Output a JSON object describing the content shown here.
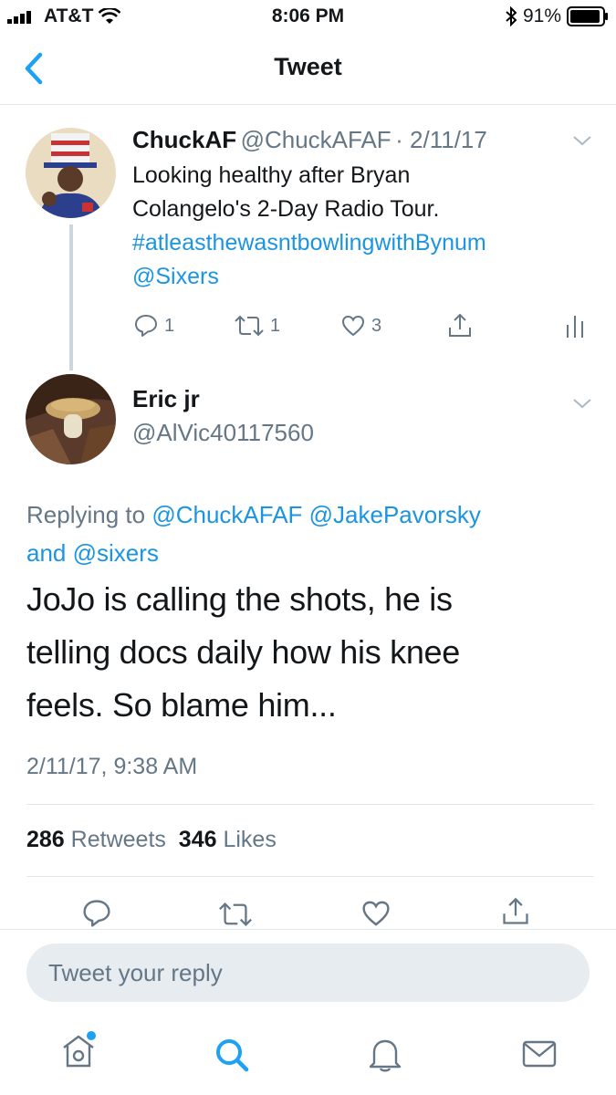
{
  "status_bar": {
    "carrier": "AT&T",
    "time": "8:06 PM",
    "battery": "91%"
  },
  "nav": {
    "title": "Tweet"
  },
  "parent_tweet": {
    "name": "ChuckAF",
    "handle": "@ChuckAFAF",
    "date": "· 2/11/17",
    "text_line1": "Looking healthy after Bryan",
    "text_line2": "Colangelo's 2-Day Radio Tour.",
    "hashtag": "#atleasthewasntbowlingwithBynum",
    "mention": "@Sixers",
    "replies": "1",
    "retweets": "1",
    "likes": "3"
  },
  "main_tweet": {
    "name": "Eric jr",
    "handle": "@AlVic40117560",
    "replying_prefix": "Replying to",
    "reply_to_1": "@ChuckAFAF",
    "reply_to_2": "@JakePavorsky",
    "reply_and": "and",
    "reply_to_3": "@sixers",
    "text_line1": "JoJo is calling the shots, he is",
    "text_line2": "telling docs daily how his knee",
    "text_line3": "feels. So blame him...",
    "timestamp": "2/11/17, 9:38 AM",
    "retweets_count": "286",
    "retweets_label": "Retweets",
    "likes_count": "346",
    "likes_label": "Likes"
  },
  "reply": {
    "placeholder": "Tweet your reply"
  },
  "colors": {
    "accent": "#1da1f2",
    "link": "#1b95e0",
    "muted": "#657786"
  }
}
